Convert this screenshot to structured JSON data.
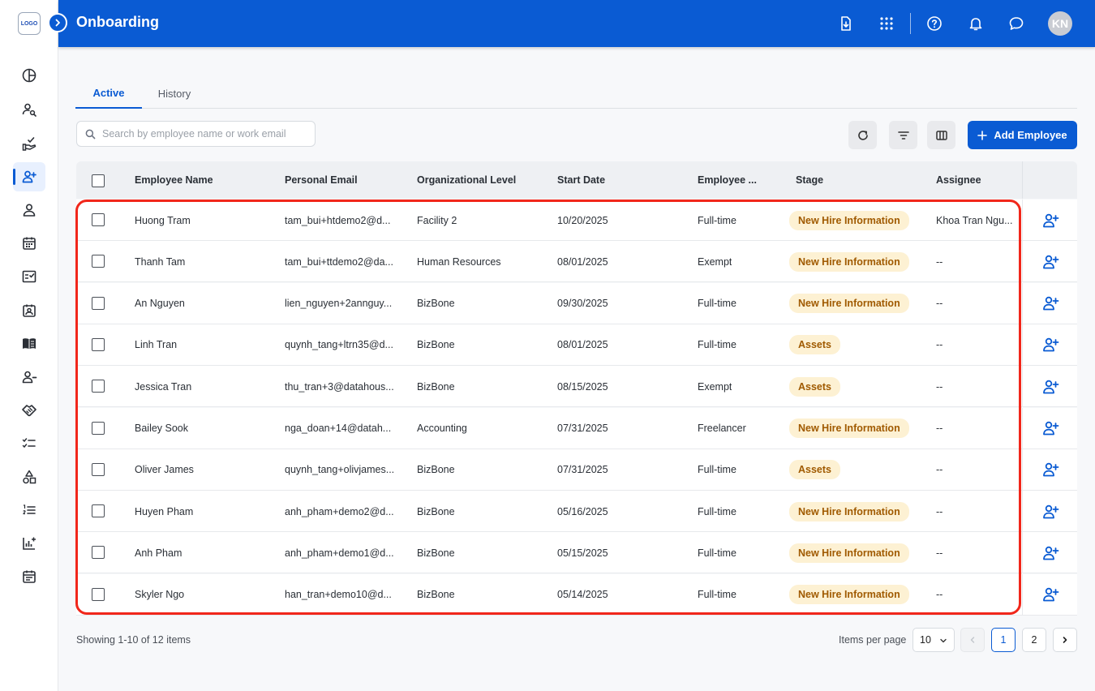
{
  "app": {
    "title": "Onboarding",
    "logo_text": "LOGO",
    "avatar_initials": "KN",
    "brand_color": "#0a5bd3"
  },
  "header_icons": [
    "download-file-icon",
    "apps-grid-icon",
    "help-icon",
    "bell-icon",
    "chat-icon"
  ],
  "sidebar": {
    "items": [
      {
        "icon": "dashboard-pie-icon",
        "active": false
      },
      {
        "icon": "user-search-icon",
        "active": false
      },
      {
        "icon": "hand-check-icon",
        "active": false
      },
      {
        "icon": "user-add-icon",
        "active": true
      },
      {
        "icon": "person-icon",
        "active": false
      },
      {
        "icon": "calendar-icon",
        "active": false
      },
      {
        "icon": "checklist-icon",
        "active": false
      },
      {
        "icon": "badge-icon",
        "active": false
      },
      {
        "icon": "book-icon",
        "active": false
      },
      {
        "icon": "user-remove-icon",
        "active": false
      },
      {
        "icon": "handshake-icon",
        "active": false
      },
      {
        "icon": "task-list-icon",
        "active": false
      },
      {
        "icon": "shapes-icon",
        "active": false
      },
      {
        "icon": "numbered-list-icon",
        "active": false
      },
      {
        "icon": "analytics-icon",
        "active": false
      },
      {
        "icon": "event-note-icon",
        "active": false
      }
    ]
  },
  "tabs": [
    {
      "label": "Active",
      "active": true
    },
    {
      "label": "History",
      "active": false
    }
  ],
  "search": {
    "placeholder": "Search by employee name or work email",
    "value": ""
  },
  "toolbar": {
    "add_label": "Add Employee"
  },
  "table": {
    "columns": [
      "Employee Name",
      "Personal Email",
      "Organizational Level",
      "Start Date",
      "Employee ...",
      "Stage",
      "Assignee"
    ],
    "rows": [
      {
        "name": "Huong Tram",
        "email": "tam_bui+htdemo2@d...",
        "org": "Facility 2",
        "start": "10/20/2025",
        "type": "Full-time",
        "stage": "New Hire Information",
        "assignee": "Khoa Tran Ngu..."
      },
      {
        "name": "Thanh Tam",
        "email": "tam_bui+ttdemo2@da...",
        "org": "Human Resources",
        "start": "08/01/2025",
        "type": "Exempt",
        "stage": "New Hire Information",
        "assignee": "--"
      },
      {
        "name": "An Nguyen",
        "email": "lien_nguyen+2annguy...",
        "org": "BizBone",
        "start": "09/30/2025",
        "type": "Full-time",
        "stage": "New Hire Information",
        "assignee": "--"
      },
      {
        "name": "Linh Tran",
        "email": "quynh_tang+ltrn35@d...",
        "org": "BizBone",
        "start": "08/01/2025",
        "type": "Full-time",
        "stage": "Assets",
        "assignee": "--"
      },
      {
        "name": "Jessica Tran",
        "email": "thu_tran+3@datahous...",
        "org": "BizBone",
        "start": "08/15/2025",
        "type": "Exempt",
        "stage": "Assets",
        "assignee": "--"
      },
      {
        "name": "Bailey Sook",
        "email": "nga_doan+14@datah...",
        "org": "Accounting",
        "start": "07/31/2025",
        "type": "Freelancer",
        "stage": "New Hire Information",
        "assignee": "--"
      },
      {
        "name": "Oliver James",
        "email": "quynh_tang+olivjames...",
        "org": "BizBone",
        "start": "07/31/2025",
        "type": "Full-time",
        "stage": "Assets",
        "assignee": "--"
      },
      {
        "name": "Huyen Pham",
        "email": "anh_pham+demo2@d...",
        "org": "BizBone",
        "start": "05/16/2025",
        "type": "Full-time",
        "stage": "New Hire Information",
        "assignee": "--"
      },
      {
        "name": "Anh Pham",
        "email": "anh_pham+demo1@d...",
        "org": "BizBone",
        "start": "05/15/2025",
        "type": "Full-time",
        "stage": "New Hire Information",
        "assignee": "--"
      },
      {
        "name": "Skyler Ngo",
        "email": "han_tran+demo10@d...",
        "org": "BizBone",
        "start": "05/14/2025",
        "type": "Full-time",
        "stage": "New Hire Information",
        "assignee": "--"
      }
    ]
  },
  "footer": {
    "showing": "Showing 1-10 of 12 items",
    "items_per_page_label": "Items per page",
    "items_per_page_value": "10",
    "pages": [
      "1",
      "2"
    ],
    "current_page": "1"
  }
}
